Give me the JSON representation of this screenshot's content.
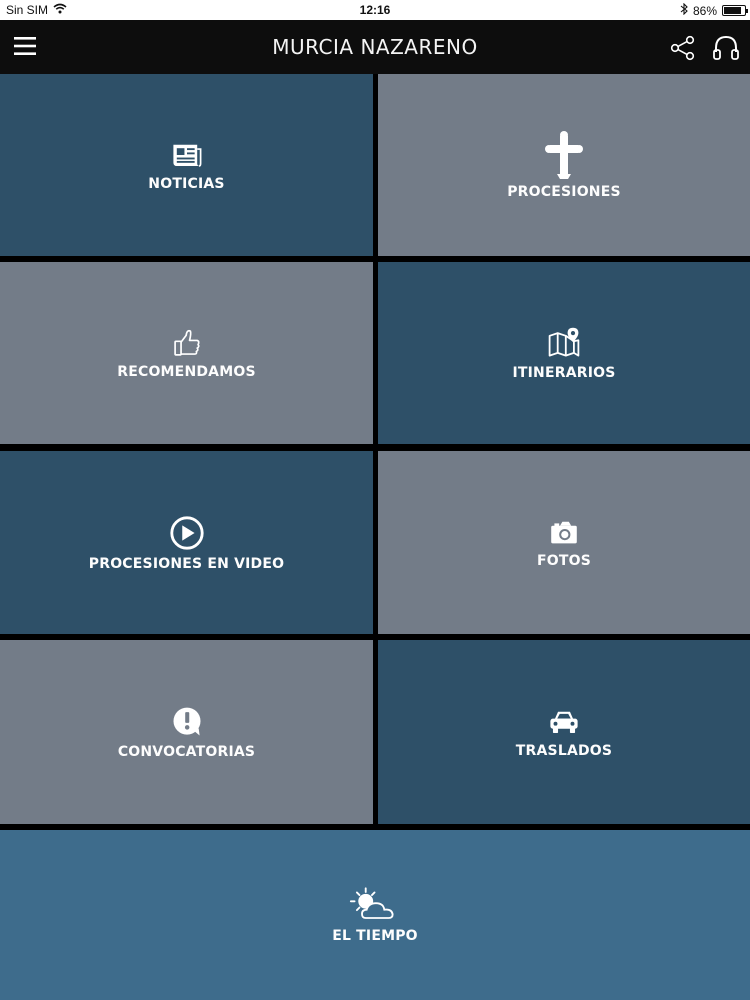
{
  "status_bar": {
    "carrier": "Sin SIM",
    "time": "12:16",
    "battery_percent": "86%",
    "battery_level": 0.86,
    "icons": [
      "wifi-icon",
      "bluetooth-icon",
      "battery-icon"
    ]
  },
  "header": {
    "title": "MURCIA NAZARENO",
    "icons": [
      "menu-icon",
      "share-icon",
      "headphones-icon"
    ]
  },
  "colors": {
    "header_bg": "#0d0d0d",
    "tile_dark": "#2e5068",
    "tile_grey": "#737c88",
    "tile_wide": "#3e6c8c",
    "divider": "#000000"
  },
  "tiles": [
    {
      "label": "NOTICIAS",
      "icon": "newspaper-icon"
    },
    {
      "label": "PROCESIONES",
      "icon": "cross-icon"
    },
    {
      "label": "RECOMENDAMOS",
      "icon": "thumbs-up-icon"
    },
    {
      "label": "ITINERARIOS",
      "icon": "map-pin-icon"
    },
    {
      "label": "PROCESIONES EN VIDEO",
      "icon": "play-icon"
    },
    {
      "label": "FOTOS",
      "icon": "camera-icon"
    },
    {
      "label": "CONVOCATORIAS",
      "icon": "alert-bubble-icon"
    },
    {
      "label": "TRASLADOS",
      "icon": "car-icon"
    },
    {
      "label": "EL TIEMPO",
      "icon": "weather-icon"
    }
  ]
}
